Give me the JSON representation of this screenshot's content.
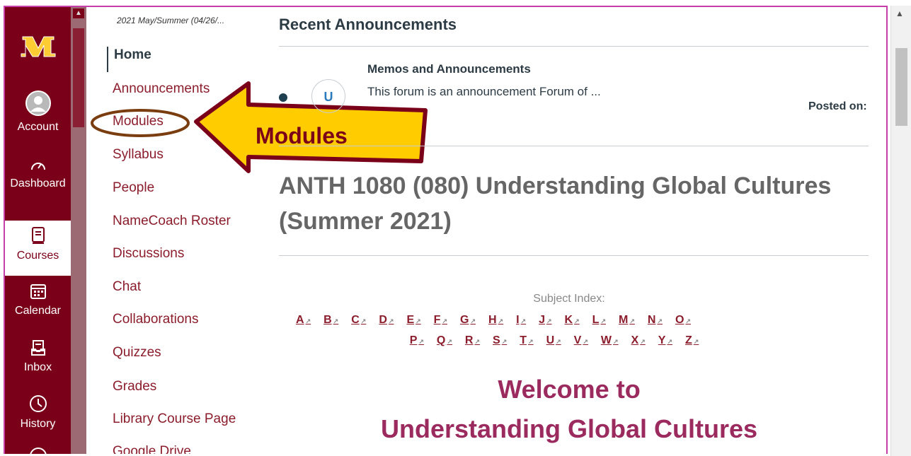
{
  "global_nav": {
    "items": [
      {
        "label": "Account",
        "icon": "user-avatar-icon"
      },
      {
        "label": "Dashboard",
        "icon": "dashboard-gauge-icon"
      },
      {
        "label": "Courses",
        "icon": "courses-book-icon"
      },
      {
        "label": "Calendar",
        "icon": "calendar-icon"
      },
      {
        "label": "Inbox",
        "icon": "inbox-icon"
      },
      {
        "label": "History",
        "icon": "history-clock-icon"
      }
    ],
    "logo_text": "M"
  },
  "course_nav": {
    "term": "2021 May/Summer (04/26/...",
    "items": [
      "Home",
      "Announcements",
      "Modules",
      "Syllabus",
      "People",
      "NameCoach Roster",
      "Discussions",
      "Chat",
      "Collaborations",
      "Quizzes",
      "Grades",
      "Library Course Page",
      "Google Drive"
    ]
  },
  "callout": {
    "label": "Modules"
  },
  "announcements": {
    "heading": "Recent Announcements",
    "item": {
      "avatar_initial": "U",
      "title": "Memos and Announcements",
      "snippet": "This forum is an announcement Forum of ...",
      "posted": "Posted on:"
    }
  },
  "course": {
    "title": "ANTH 1080 (080) Understanding Global Cultures (Summer 2021)",
    "subject_index_label": "Subject Index:",
    "letters_row1": [
      "A",
      "B",
      "C",
      "D",
      "E",
      "F",
      "G",
      "H",
      "I",
      "J",
      "K",
      "L",
      "M",
      "N",
      "O"
    ],
    "letters_row2": [
      "P",
      "Q",
      "R",
      "S",
      "T",
      "U",
      "V",
      "W",
      "X",
      "Y",
      "Z"
    ],
    "welcome_line1": "Welcome to",
    "welcome_line2": "Understanding Global Cultures"
  },
  "colors": {
    "maroon": "#7a0019",
    "gold": "#ffcc33",
    "accent_pink": "#9b2b5f"
  }
}
